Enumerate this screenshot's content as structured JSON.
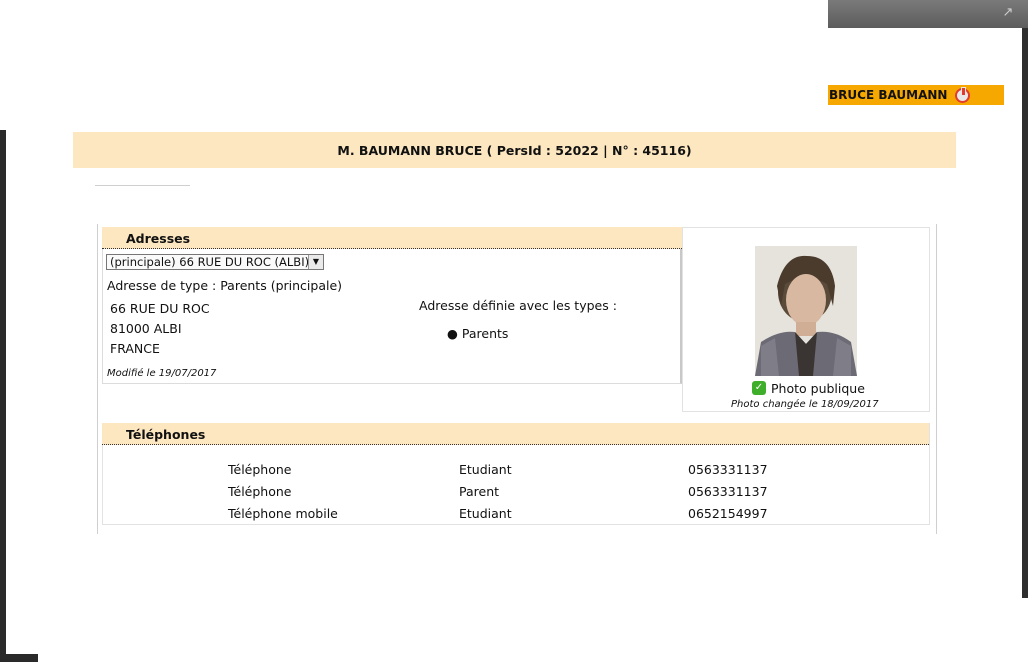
{
  "window": {
    "expand_icon": "expand-icon"
  },
  "user": {
    "name": "BRUCE BAUMANN",
    "logout_icon": "power-icon"
  },
  "header": {
    "title": "M. BAUMANN BRUCE ( PersId : 52022 | N° : 45116)"
  },
  "addresses": {
    "heading": "Adresses",
    "select_value": "(principale) 66 RUE DU ROC (ALBI)",
    "type_line": "Adresse de type : Parents (principale)",
    "lines": [
      "66 RUE DU ROC",
      "81000  ALBI",
      "FRANCE"
    ],
    "defined_label": "Adresse définie avec les types :",
    "types": [
      "Parents"
    ],
    "modified": "Modifié le 19/07/2017"
  },
  "photo": {
    "label": "Photo publique",
    "changed": "Photo changée le 18/09/2017",
    "public_icon": "thumbs-up-icon"
  },
  "phones": {
    "heading": "Téléphones",
    "rows": [
      {
        "type": "Téléphone",
        "owner": "Etudiant",
        "number": "0563331137"
      },
      {
        "type": "Téléphone",
        "owner": "Parent",
        "number": "0563331137"
      },
      {
        "type": "Téléphone mobile",
        "owner": "Etudiant",
        "number": "0652154997"
      }
    ]
  },
  "colors": {
    "accent_orange": "#f6a800",
    "section_bg": "#fde7c0",
    "public_green": "#3fae2a"
  }
}
